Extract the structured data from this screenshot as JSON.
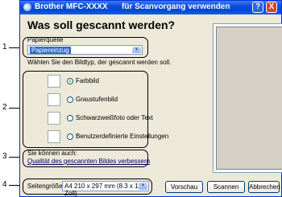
{
  "callouts": [
    "1",
    "2",
    "3",
    "4"
  ],
  "window": {
    "title_left": "Brother MFC-XXXX",
    "title_right": "für Scanvorgang verwenden",
    "help_label": "?",
    "close_label": "X"
  },
  "heading": "Was soll gescannt werden?",
  "paper_source": {
    "label": "Papierquelle",
    "value": "Papiereinzug"
  },
  "type_prompt": "Wählen Sie den Bildtyp, der gescannt werden soll.",
  "image_types": [
    {
      "label": "Farbbild",
      "selected": true
    },
    {
      "label": "Graustufenbild",
      "selected": false
    },
    {
      "label": "Schwarzweißfoto oder Text",
      "selected": false
    },
    {
      "label": "Benutzerdefinierte Einstellungen",
      "selected": false
    }
  ],
  "also": {
    "label": "Sie können auch:",
    "link": "Qualität des gescannten Bildes verbessern"
  },
  "page_size": {
    "label": "Seitengröße:",
    "value": "A4 210 x 297 mm (8.3 x 11.7 Zoll)"
  },
  "buttons": {
    "preview": "Vorschau",
    "scan": "Scannen",
    "cancel": "Abbrechen"
  }
}
